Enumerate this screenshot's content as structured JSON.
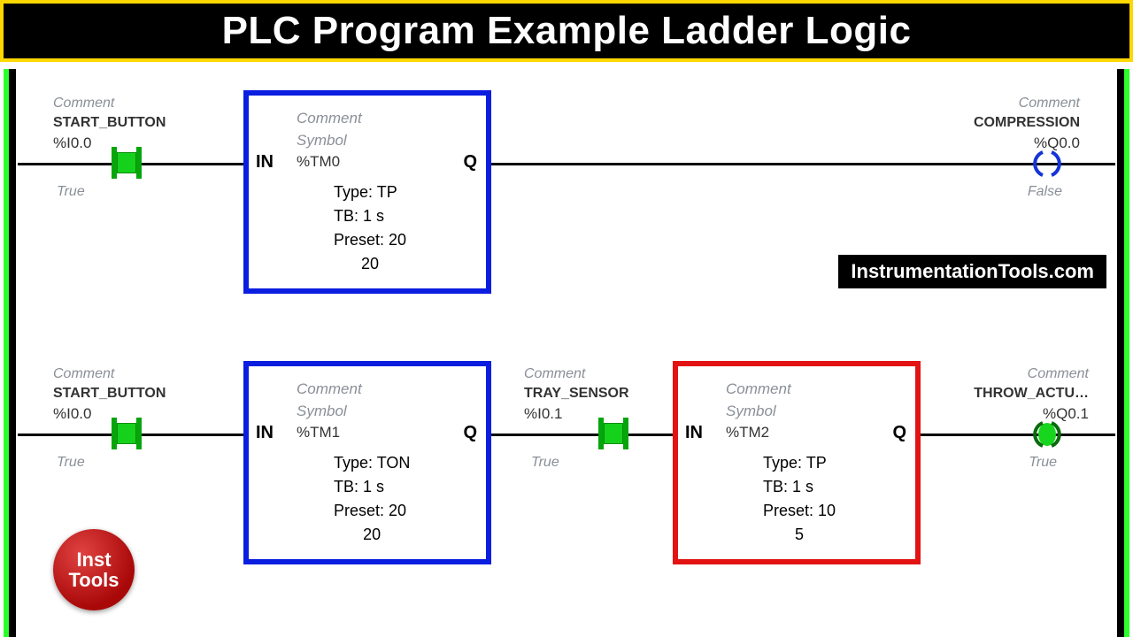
{
  "title": "PLC Program Example Ladder Logic",
  "watermark": "InstrumentationTools.com",
  "badge": {
    "line1": "Inst",
    "line2": "Tools"
  },
  "comment_label": "Comment",
  "symbol_label": "Symbol",
  "rung1": {
    "contact": {
      "name": "START_BUTTON",
      "address": "%I0.0",
      "state": "True"
    },
    "timer": {
      "address": "%TM0",
      "type_label": "Type:",
      "type": "TP",
      "tb_label": "TB:",
      "tb": "1 s",
      "preset_label": "Preset:",
      "preset": "20",
      "current": "20",
      "in": "IN",
      "q": "Q"
    },
    "coil": {
      "name": "COMPRESSION",
      "address": "%Q0.0",
      "state": "False",
      "active": false
    }
  },
  "rung2": {
    "contact1": {
      "name": "START_BUTTON",
      "address": "%I0.0",
      "state": "True"
    },
    "timer1": {
      "address": "%TM1",
      "type_label": "Type:",
      "type": "TON",
      "tb_label": "TB:",
      "tb": "1 s",
      "preset_label": "Preset:",
      "preset": "20",
      "current": "20",
      "in": "IN",
      "q": "Q"
    },
    "contact2": {
      "name": "TRAY_SENSOR",
      "address": "%I0.1",
      "state": "True"
    },
    "timer2": {
      "address": "%TM2",
      "type_label": "Type:",
      "type": "TP",
      "tb_label": "TB:",
      "tb": "1 s",
      "preset_label": "Preset:",
      "preset": "10",
      "current": "5",
      "in": "IN",
      "q": "Q"
    },
    "coil": {
      "name": "THROW_ACTU…",
      "address": "%Q0.1",
      "state": "True",
      "active": true
    }
  }
}
